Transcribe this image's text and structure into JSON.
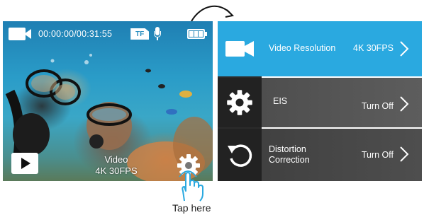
{
  "status": {
    "time": "00:00:00/00:31:55",
    "storage_badge": "TF"
  },
  "preview": {
    "mode_name": "Video",
    "mode_value": "4K 30FPS"
  },
  "menu": {
    "items": [
      {
        "label": "Video Resolution",
        "value": "4K 30FPS",
        "icon": "video-camera-icon"
      },
      {
        "label": "EIS",
        "value": "Turn Off",
        "icon": "gear-icon"
      },
      {
        "label": "Distortion Correction",
        "label_line1": "Distortion",
        "label_line2": "Correction",
        "value": "Turn Off",
        "icon": "rotate-icon"
      }
    ]
  },
  "hint": {
    "text": "Tap here"
  },
  "colors": {
    "accent": "#2aa9e0",
    "menu_bg": "#2b2b2b",
    "hand": "#2aa9e0"
  }
}
